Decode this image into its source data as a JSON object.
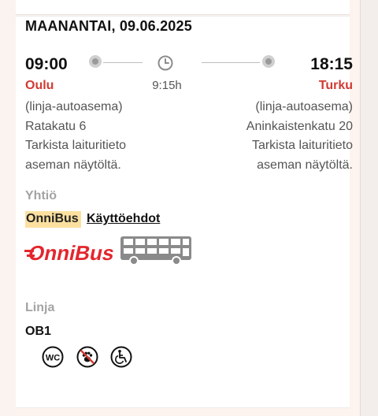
{
  "trip": {
    "date": "MAANANTAI, 09.06.2025",
    "departure": {
      "time": "09:00",
      "city": "Oulu",
      "address_lines": [
        "(linja-autoasema)",
        "Ratakatu 6",
        "Tarkista laituritieto",
        "aseman näytöltä."
      ]
    },
    "arrival": {
      "time": "18:15",
      "city": "Turku",
      "address_lines": [
        "(linja-autoasema)",
        "Aninkaistenkatu 20",
        "Tarkista laituritieto",
        "aseman näytöltä."
      ]
    },
    "duration": "9:15h"
  },
  "company": {
    "heading": "Yhtiö",
    "name": "OnniBus",
    "terms_link": "Käyttöehdot",
    "logo_text": "OnniBus"
  },
  "line": {
    "heading": "Linja",
    "code": "OB1"
  },
  "amenities": {
    "wc_label": "WC",
    "icons": [
      "wc-icon",
      "no-pets-icon",
      "wheelchair-icon"
    ]
  },
  "colors": {
    "accent_red": "#d13a32",
    "company_highlight": "#fbe09f",
    "brand_red": "#e3262e"
  }
}
